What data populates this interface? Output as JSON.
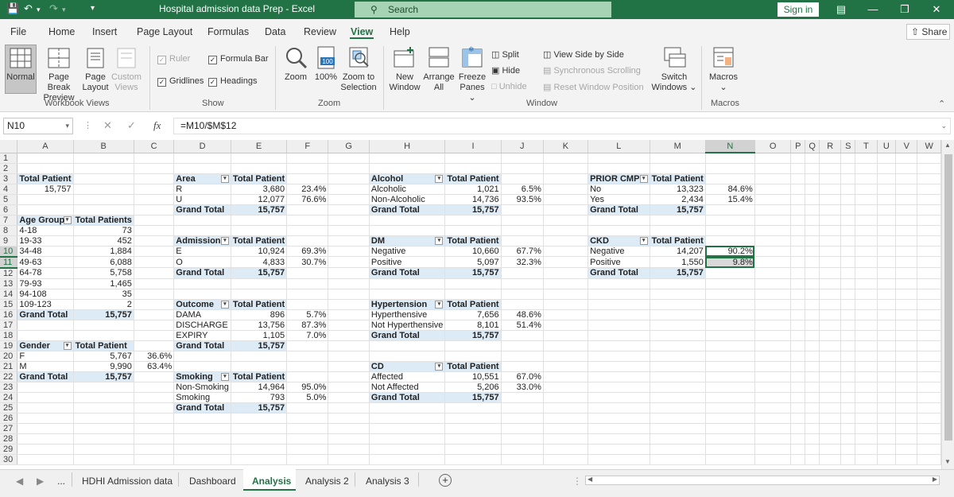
{
  "app": {
    "window_title": "Hospital admission data Prep  -  Excel",
    "search_placeholder": "Search",
    "sign_in": "Sign in"
  },
  "menu": {
    "tabs": [
      "File",
      "Home",
      "Insert",
      "Page Layout",
      "Formulas",
      "Data",
      "Review",
      "View",
      "Help"
    ],
    "active": "View",
    "share": "Share"
  },
  "ribbon": {
    "workbook_views": {
      "label": "Workbook Views",
      "normal": "Normal",
      "page_break_1": "Page Break",
      "page_break_2": "Preview",
      "page_layout_1": "Page",
      "page_layout_2": "Layout",
      "custom_views_1": "Custom",
      "custom_views_2": "Views"
    },
    "show": {
      "label": "Show",
      "ruler": "Ruler",
      "formula_bar": "Formula Bar",
      "gridlines": "Gridlines",
      "headings": "Headings"
    },
    "zoom": {
      "label": "Zoom",
      "zoom": "Zoom",
      "zoom100": "100%",
      "zoom_to_selection_1": "Zoom to",
      "zoom_to_selection_2": "Selection",
      "icon_100": "100"
    },
    "window": {
      "label": "Window",
      "new_window_1": "New",
      "new_window_2": "Window",
      "arrange_1": "Arrange",
      "arrange_2": "All",
      "freeze_1": "Freeze",
      "freeze_2": "Panes",
      "split": "Split",
      "hide": "Hide",
      "unhide": "Unhide",
      "side_by_side": "View Side by Side",
      "sync_scroll": "Synchronous Scrolling",
      "reset_position": "Reset Window Position",
      "switch_1": "Switch",
      "switch_2": "Windows"
    },
    "macros": {
      "label": "Macros",
      "macros": "Macros"
    }
  },
  "formula_bar": {
    "name_box": "N10",
    "formula": "=M10/$M$12"
  },
  "columns": [
    "A",
    "B",
    "C",
    "D",
    "E",
    "F",
    "G",
    "H",
    "I",
    "J",
    "K",
    "L",
    "M",
    "N",
    "O",
    "P",
    "Q",
    "R",
    "S",
    "T",
    "U",
    "V",
    "W"
  ],
  "rows": [
    {
      "n": "1",
      "cells": []
    },
    {
      "n": "2",
      "cells": []
    },
    {
      "n": "3",
      "cells": [
        {
          "c": 0,
          "v": "Total Patient",
          "cls": "hdr"
        },
        {
          "c": 3,
          "v": "Area",
          "cls": "hdr",
          "dd": true
        },
        {
          "c": 4,
          "v": "Total Patient",
          "cls": "hdr"
        },
        {
          "c": 7,
          "v": "Alcohol",
          "cls": "hdr",
          "dd": true
        },
        {
          "c": 8,
          "v": "Total Patient",
          "cls": "hdr"
        },
        {
          "c": 11,
          "v": "PRIOR CMP",
          "cls": "hdr",
          "dd": true
        },
        {
          "c": 12,
          "v": "Total Patient",
          "cls": "hdr"
        }
      ]
    },
    {
      "n": "4",
      "cells": [
        {
          "c": 0,
          "v": "15,757",
          "cls": "num"
        },
        {
          "c": 3,
          "v": "R"
        },
        {
          "c": 4,
          "v": "3,680",
          "cls": "num"
        },
        {
          "c": 5,
          "v": "23.4%",
          "cls": "num"
        },
        {
          "c": 7,
          "v": "Alcoholic"
        },
        {
          "c": 8,
          "v": "1,021",
          "cls": "num"
        },
        {
          "c": 9,
          "v": "6.5%",
          "cls": "num"
        },
        {
          "c": 11,
          "v": "No"
        },
        {
          "c": 12,
          "v": "13,323",
          "cls": "num"
        },
        {
          "c": 13,
          "v": "84.6%",
          "cls": "num"
        }
      ]
    },
    {
      "n": "5",
      "cells": [
        {
          "c": 3,
          "v": "U"
        },
        {
          "c": 4,
          "v": "12,077",
          "cls": "num"
        },
        {
          "c": 5,
          "v": "76.6%",
          "cls": "num"
        },
        {
          "c": 7,
          "v": "Non-Alcoholic"
        },
        {
          "c": 8,
          "v": "14,736",
          "cls": "num"
        },
        {
          "c": 9,
          "v": "93.5%",
          "cls": "num"
        },
        {
          "c": 11,
          "v": "Yes"
        },
        {
          "c": 12,
          "v": "2,434",
          "cls": "num"
        },
        {
          "c": 13,
          "v": "15.4%",
          "cls": "num"
        }
      ]
    },
    {
      "n": "6",
      "cells": [
        {
          "c": 3,
          "v": "Grand Total",
          "cls": "tot"
        },
        {
          "c": 4,
          "v": "15,757",
          "cls": "tot num"
        },
        {
          "c": 7,
          "v": "Grand Total",
          "cls": "tot"
        },
        {
          "c": 8,
          "v": "15,757",
          "cls": "tot num"
        },
        {
          "c": 11,
          "v": "Grand Total",
          "cls": "tot"
        },
        {
          "c": 12,
          "v": "15,757",
          "cls": "tot num"
        }
      ]
    },
    {
      "n": "7",
      "cells": [
        {
          "c": 0,
          "v": "Age Group",
          "cls": "hdr",
          "dd": true
        },
        {
          "c": 1,
          "v": "Total Patients",
          "cls": "hdr"
        }
      ]
    },
    {
      "n": "8",
      "cells": [
        {
          "c": 0,
          "v": "4-18"
        },
        {
          "c": 1,
          "v": "73",
          "cls": "num"
        }
      ]
    },
    {
      "n": "9",
      "cells": [
        {
          "c": 0,
          "v": "19-33"
        },
        {
          "c": 1,
          "v": "452",
          "cls": "num"
        },
        {
          "c": 3,
          "v": "Admission",
          "cls": "hdr",
          "dd": true
        },
        {
          "c": 4,
          "v": "Total Patient",
          "cls": "hdr"
        },
        {
          "c": 7,
          "v": "DM",
          "cls": "hdr",
          "dd": true
        },
        {
          "c": 8,
          "v": "Total Patient",
          "cls": "hdr"
        },
        {
          "c": 11,
          "v": "CKD",
          "cls": "hdr",
          "dd": true
        },
        {
          "c": 12,
          "v": "Total Patient",
          "cls": "hdr"
        }
      ]
    },
    {
      "n": "10",
      "sel": true,
      "cells": [
        {
          "c": 0,
          "v": "34-48"
        },
        {
          "c": 1,
          "v": "1,884",
          "cls": "num"
        },
        {
          "c": 3,
          "v": "E"
        },
        {
          "c": 4,
          "v": "10,924",
          "cls": "num"
        },
        {
          "c": 5,
          "v": "69.3%",
          "cls": "num"
        },
        {
          "c": 7,
          "v": "Negative"
        },
        {
          "c": 8,
          "v": "10,660",
          "cls": "num"
        },
        {
          "c": 9,
          "v": "67.7%",
          "cls": "num"
        },
        {
          "c": 11,
          "v": "Negative"
        },
        {
          "c": 12,
          "v": "14,207",
          "cls": "num"
        },
        {
          "c": 13,
          "v": "90.2%",
          "cls": "num selcell"
        }
      ]
    },
    {
      "n": "11",
      "sel": true,
      "cells": [
        {
          "c": 0,
          "v": "49-63"
        },
        {
          "c": 1,
          "v": "6,088",
          "cls": "num"
        },
        {
          "c": 3,
          "v": "O"
        },
        {
          "c": 4,
          "v": "4,833",
          "cls": "num"
        },
        {
          "c": 5,
          "v": "30.7%",
          "cls": "num"
        },
        {
          "c": 7,
          "v": "Positive"
        },
        {
          "c": 8,
          "v": "5,097",
          "cls": "num"
        },
        {
          "c": 9,
          "v": "32.3%",
          "cls": "num"
        },
        {
          "c": 11,
          "v": "Positive"
        },
        {
          "c": 12,
          "v": "1,550",
          "cls": "num"
        },
        {
          "c": 13,
          "v": "9.8%",
          "cls": "num selcell2"
        }
      ]
    },
    {
      "n": "12",
      "cells": [
        {
          "c": 0,
          "v": "64-78"
        },
        {
          "c": 1,
          "v": "5,758",
          "cls": "num"
        },
        {
          "c": 3,
          "v": "Grand Total",
          "cls": "tot"
        },
        {
          "c": 4,
          "v": "15,757",
          "cls": "tot num"
        },
        {
          "c": 7,
          "v": "Grand Total",
          "cls": "tot"
        },
        {
          "c": 8,
          "v": "15,757",
          "cls": "tot num"
        },
        {
          "c": 11,
          "v": "Grand Total",
          "cls": "tot"
        },
        {
          "c": 12,
          "v": "15,757",
          "cls": "tot num"
        }
      ]
    },
    {
      "n": "13",
      "cells": [
        {
          "c": 0,
          "v": "79-93"
        },
        {
          "c": 1,
          "v": "1,465",
          "cls": "num"
        }
      ]
    },
    {
      "n": "14",
      "cells": [
        {
          "c": 0,
          "v": "94-108"
        },
        {
          "c": 1,
          "v": "35",
          "cls": "num"
        }
      ]
    },
    {
      "n": "15",
      "cells": [
        {
          "c": 0,
          "v": "109-123"
        },
        {
          "c": 1,
          "v": "2",
          "cls": "num"
        },
        {
          "c": 3,
          "v": "Outcome",
          "cls": "hdr",
          "dd": true
        },
        {
          "c": 4,
          "v": "Total Patient",
          "cls": "hdr"
        },
        {
          "c": 7,
          "v": "Hypertension",
          "cls": "hdr",
          "dd": true
        },
        {
          "c": 8,
          "v": "Total Patient",
          "cls": "hdr"
        }
      ]
    },
    {
      "n": "16",
      "cells": [
        {
          "c": 0,
          "v": "Grand Total",
          "cls": "tot"
        },
        {
          "c": 1,
          "v": "15,757",
          "cls": "tot num"
        },
        {
          "c": 3,
          "v": "DAMA"
        },
        {
          "c": 4,
          "v": "896",
          "cls": "num"
        },
        {
          "c": 5,
          "v": "5.7%",
          "cls": "num"
        },
        {
          "c": 7,
          "v": "Hyperthensive"
        },
        {
          "c": 8,
          "v": "7,656",
          "cls": "num"
        },
        {
          "c": 9,
          "v": "48.6%",
          "cls": "num"
        }
      ]
    },
    {
      "n": "17",
      "cells": [
        {
          "c": 3,
          "v": "DISCHARGE"
        },
        {
          "c": 4,
          "v": "13,756",
          "cls": "num"
        },
        {
          "c": 5,
          "v": "87.3%",
          "cls": "num"
        },
        {
          "c": 7,
          "v": "Not Hyperthensive"
        },
        {
          "c": 8,
          "v": "8,101",
          "cls": "num"
        },
        {
          "c": 9,
          "v": "51.4%",
          "cls": "num"
        }
      ]
    },
    {
      "n": "18",
      "cells": [
        {
          "c": 3,
          "v": "EXPIRY"
        },
        {
          "c": 4,
          "v": "1,105",
          "cls": "num"
        },
        {
          "c": 5,
          "v": "7.0%",
          "cls": "num"
        },
        {
          "c": 7,
          "v": "Grand Total",
          "cls": "tot"
        },
        {
          "c": 8,
          "v": "15,757",
          "cls": "tot num"
        }
      ]
    },
    {
      "n": "19",
      "cells": [
        {
          "c": 0,
          "v": "Gender",
          "cls": "hdr",
          "dd": true
        },
        {
          "c": 1,
          "v": "Total Patient",
          "cls": "hdr"
        },
        {
          "c": 3,
          "v": "Grand Total",
          "cls": "tot"
        },
        {
          "c": 4,
          "v": "15,757",
          "cls": "tot num"
        }
      ]
    },
    {
      "n": "20",
      "cells": [
        {
          "c": 0,
          "v": "F"
        },
        {
          "c": 1,
          "v": "5,767",
          "cls": "num"
        },
        {
          "c": 2,
          "v": "36.6%",
          "cls": "num"
        }
      ]
    },
    {
      "n": "21",
      "cells": [
        {
          "c": 0,
          "v": "M"
        },
        {
          "c": 1,
          "v": "9,990",
          "cls": "num"
        },
        {
          "c": 2,
          "v": "63.4%",
          "cls": "num"
        },
        {
          "c": 7,
          "v": "CD",
          "cls": "hdr",
          "dd": true
        },
        {
          "c": 8,
          "v": "Total Patient",
          "cls": "hdr"
        }
      ]
    },
    {
      "n": "22",
      "cells": [
        {
          "c": 0,
          "v": "Grand Total",
          "cls": "tot"
        },
        {
          "c": 1,
          "v": "15,757",
          "cls": "tot num"
        },
        {
          "c": 3,
          "v": "Smoking",
          "cls": "hdr",
          "dd": true
        },
        {
          "c": 4,
          "v": "Total Patient",
          "cls": "hdr"
        },
        {
          "c": 7,
          "v": "Affected"
        },
        {
          "c": 8,
          "v": "10,551",
          "cls": "num"
        },
        {
          "c": 9,
          "v": "67.0%",
          "cls": "num"
        }
      ]
    },
    {
      "n": "23",
      "cells": [
        {
          "c": 3,
          "v": "Non-Smoking"
        },
        {
          "c": 4,
          "v": "14,964",
          "cls": "num"
        },
        {
          "c": 5,
          "v": "95.0%",
          "cls": "num"
        },
        {
          "c": 7,
          "v": "Not Affected"
        },
        {
          "c": 8,
          "v": "5,206",
          "cls": "num"
        },
        {
          "c": 9,
          "v": "33.0%",
          "cls": "num"
        }
      ]
    },
    {
      "n": "24",
      "cells": [
        {
          "c": 3,
          "v": "Smoking"
        },
        {
          "c": 4,
          "v": "793",
          "cls": "num"
        },
        {
          "c": 5,
          "v": "5.0%",
          "cls": "num"
        },
        {
          "c": 7,
          "v": "Grand Total",
          "cls": "tot"
        },
        {
          "c": 8,
          "v": "15,757",
          "cls": "tot num"
        }
      ]
    },
    {
      "n": "25",
      "cells": [
        {
          "c": 3,
          "v": "Grand Total",
          "cls": "tot"
        },
        {
          "c": 4,
          "v": "15,757",
          "cls": "tot num"
        }
      ]
    },
    {
      "n": "26",
      "cells": []
    },
    {
      "n": "27",
      "cells": []
    },
    {
      "n": "28",
      "cells": []
    },
    {
      "n": "29",
      "cells": []
    },
    {
      "n": "30",
      "cells": []
    }
  ],
  "sheet_tabs": {
    "more": "...",
    "tabs": [
      "HDHI Admission data",
      "Dashboard",
      "Analysis",
      "Analysis 2",
      "Analysis 3"
    ],
    "active": "Analysis",
    "add": "+"
  },
  "colors": {
    "accent": "#217346",
    "pivot_header": "#ddebf7"
  }
}
